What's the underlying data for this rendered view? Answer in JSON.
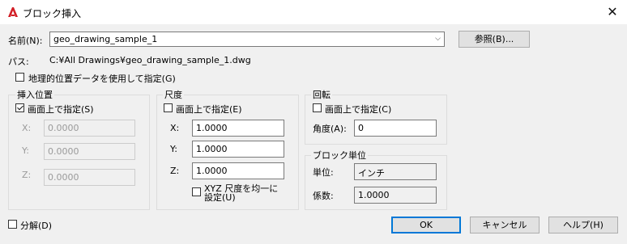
{
  "window": {
    "title": "ブロック挿入",
    "close_glyph": "✕",
    "app_icon": "autocad-A-icon"
  },
  "name": {
    "label": "名前(N):",
    "value": "geo_drawing_sample_1"
  },
  "browse_button": "参照(B)...",
  "path": {
    "label": "パス:",
    "value": "C:¥All Drawings¥geo_drawing_sample_1.dwg"
  },
  "geo_location": {
    "label": "地理的位置データを使用して指定(G)",
    "checked": false
  },
  "insertion": {
    "title": "挿入位置",
    "specify_on_screen": "画面上で指定(S)",
    "x_label": "X:",
    "x_value": "0.0000",
    "y_label": "Y:",
    "y_value": "0.0000",
    "z_label": "Z:",
    "z_value": "0.0000"
  },
  "scale": {
    "title": "尺度",
    "specify_on_screen": "画面上で指定(E)",
    "x_label": "X:",
    "x_value": "1.0000",
    "y_label": "Y:",
    "y_value": "1.0000",
    "z_label": "Z:",
    "z_value": "1.0000",
    "uniform_line1": "XYZ 尺度を均一に",
    "uniform_line2": "設定(U)"
  },
  "rotation": {
    "title": "回転",
    "specify_on_screen": "画面上で指定(C)",
    "angle_label": "角度(A):",
    "angle_value": "0"
  },
  "block_unit": {
    "title": "ブロック単位",
    "unit_label": "単位:",
    "unit_value": "インチ",
    "factor_label": "係数:",
    "factor_value": "1.0000"
  },
  "explode": {
    "label": "分解(D)"
  },
  "buttons": {
    "ok": "OK",
    "cancel": "キャンセル",
    "help": "ヘルプ(H)"
  }
}
